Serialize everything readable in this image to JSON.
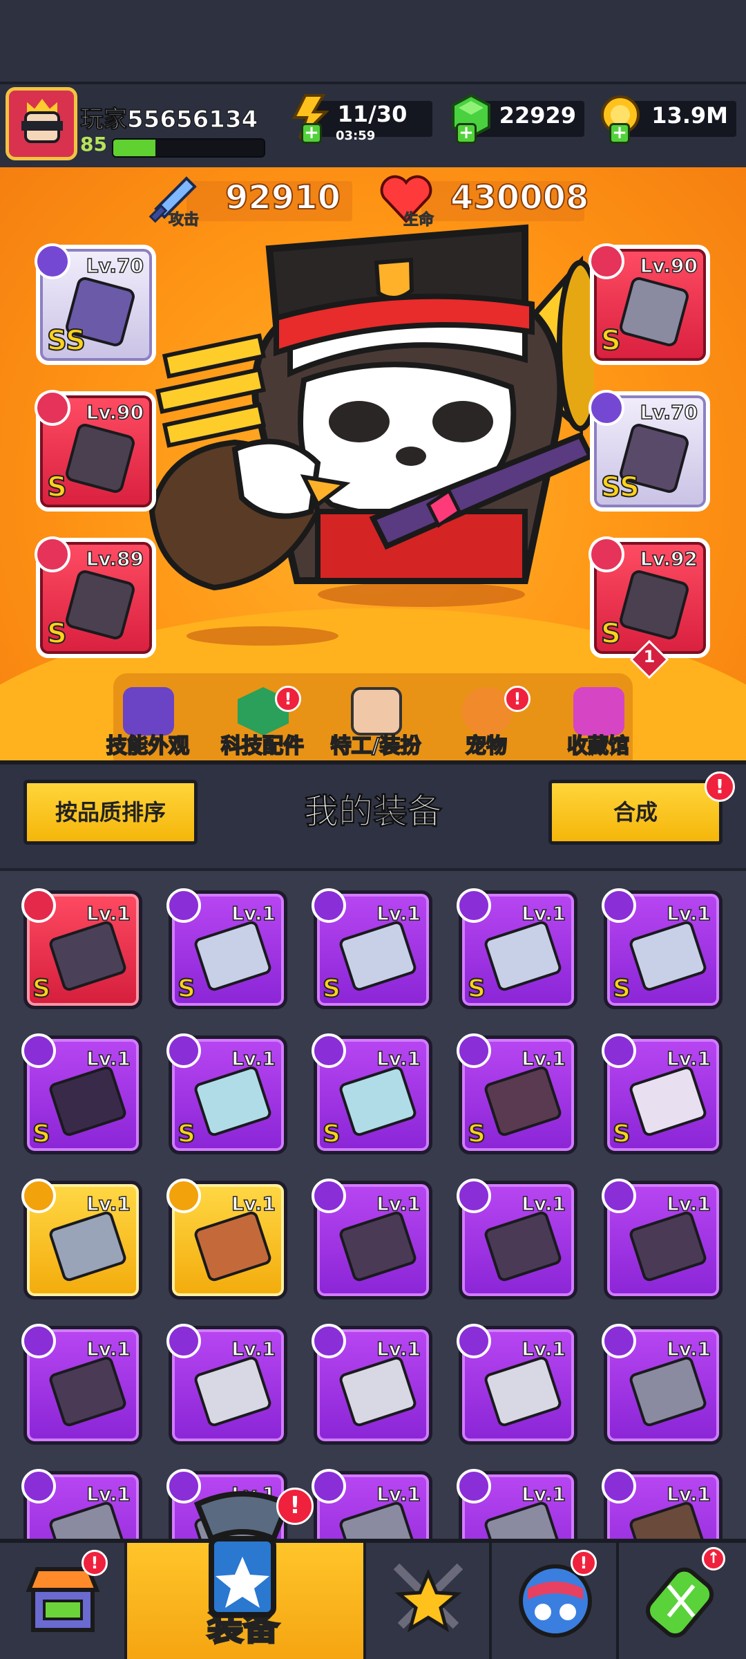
{
  "player": {
    "name": "玩家55656134",
    "level": "85",
    "xp_fraction": 0.28
  },
  "resources": {
    "energy": {
      "value": "11/30",
      "timer": "03:59",
      "icon": "lightning-icon"
    },
    "gems": {
      "value": "22929",
      "icon": "green-gem-icon"
    },
    "coins": {
      "value": "13.9M",
      "icon": "gold-coin-icon"
    }
  },
  "stats": {
    "attack": {
      "label": "攻击",
      "value": "92910"
    },
    "hp": {
      "label": "生命",
      "value": "430008"
    }
  },
  "equipped": [
    {
      "level": "Lv.70",
      "rank": "SS",
      "slot": "weapon"
    },
    {
      "level": "Lv.90",
      "rank": "S",
      "slot": "necklace"
    },
    {
      "level": "Lv.89",
      "rank": "S",
      "slot": "gloves"
    },
    {
      "level": "Lv.90",
      "rank": "S",
      "slot": "armor"
    },
    {
      "level": "Lv.70",
      "rank": "SS",
      "slot": "belt"
    },
    {
      "level": "Lv.92",
      "rank": "S",
      "slot": "boots",
      "count": "1"
    }
  ],
  "feature_nav": [
    {
      "label": "技能外观",
      "badge": false
    },
    {
      "label": "科技配件",
      "badge": true
    },
    {
      "label": "特工/装扮",
      "badge": false
    },
    {
      "label": "宠物",
      "badge": true
    },
    {
      "label": "收藏馆",
      "badge": false
    }
  ],
  "section": {
    "sort_label": "按品质排序",
    "title": "我的装备",
    "merge_label": "合成",
    "badge": "!"
  },
  "inventory": [
    {
      "level": "Lv.1",
      "rank": "S",
      "color": "red",
      "item": "belt"
    },
    {
      "level": "Lv.1",
      "rank": "S",
      "color": "purple",
      "item": "blaster"
    },
    {
      "level": "Lv.1",
      "rank": "S",
      "color": "purple",
      "item": "blaster"
    },
    {
      "level": "Lv.1",
      "rank": "S",
      "color": "purple",
      "item": "blaster"
    },
    {
      "level": "Lv.1",
      "rank": "S",
      "color": "purple",
      "item": "blaster"
    },
    {
      "level": "Lv.1",
      "rank": "S",
      "color": "purple",
      "item": "shuriken"
    },
    {
      "level": "Lv.1",
      "rank": "S",
      "color": "purple",
      "item": "gauntlet"
    },
    {
      "level": "Lv.1",
      "rank": "S",
      "color": "purple",
      "item": "gauntlet"
    },
    {
      "level": "Lv.1",
      "rank": "S",
      "color": "purple",
      "item": "dark-gauntlet"
    },
    {
      "level": "Lv.1",
      "rank": "S",
      "color": "purple",
      "item": "boots"
    },
    {
      "level": "Lv.1",
      "rank": "",
      "color": "gold",
      "item": "armor"
    },
    {
      "level": "Lv.1",
      "rank": "",
      "color": "gold",
      "item": "fang-necklace"
    },
    {
      "level": "Lv.1",
      "rank": "",
      "color": "purple",
      "item": "kunai"
    },
    {
      "level": "Lv.1",
      "rank": "",
      "color": "purple",
      "item": "kunai"
    },
    {
      "level": "Lv.1",
      "rank": "",
      "color": "purple",
      "item": "kunai"
    },
    {
      "level": "Lv.1",
      "rank": "",
      "color": "purple",
      "item": "kunai"
    },
    {
      "level": "Lv.1",
      "rank": "",
      "color": "purple",
      "item": "saber"
    },
    {
      "level": "Lv.1",
      "rank": "",
      "color": "purple",
      "item": "saber"
    },
    {
      "level": "Lv.1",
      "rank": "",
      "color": "purple",
      "item": "saber"
    },
    {
      "level": "Lv.1",
      "rank": "",
      "color": "purple",
      "item": "revolver"
    },
    {
      "level": "Lv.1",
      "rank": "",
      "color": "purple",
      "item": "revolver"
    },
    {
      "level": "Lv.1",
      "rank": "",
      "color": "purple",
      "item": "revolver"
    },
    {
      "level": "Lv.1",
      "rank": "",
      "color": "purple",
      "item": "revolver"
    },
    {
      "level": "Lv.1",
      "rank": "",
      "color": "purple",
      "item": "revolver"
    },
    {
      "level": "Lv.1",
      "rank": "",
      "color": "purple",
      "item": "shotgun"
    }
  ],
  "bottom_nav": [
    {
      "id": "shop",
      "label": "",
      "badge": true
    },
    {
      "id": "equipment",
      "label": "装备",
      "badge": true,
      "active": true
    },
    {
      "id": "battle",
      "label": "",
      "badge": false
    },
    {
      "id": "world",
      "label": "",
      "badge": true
    },
    {
      "id": "evolve",
      "label": "",
      "badge": false
    }
  ]
}
